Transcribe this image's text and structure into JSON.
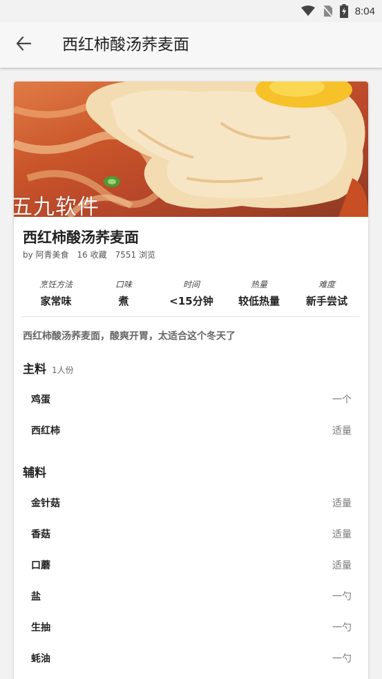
{
  "status_bar": {
    "time": "8:04",
    "icons": [
      "wifi-icon",
      "no-sim-icon",
      "battery-charging-icon"
    ]
  },
  "app_bar": {
    "back_icon": "arrow-left-icon",
    "title": "西红柿酸汤荞麦面"
  },
  "hero": {
    "watermark": "五九软件"
  },
  "recipe": {
    "title": "西红柿酸汤荞麦面",
    "author": "by 阿青美食",
    "favorites": "16 收藏",
    "views": "7551 浏览",
    "attributes": [
      {
        "label": "烹饪方法",
        "value": "家常味"
      },
      {
        "label": "口味",
        "value": "煮"
      },
      {
        "label": "时间",
        "value": "<15分钟"
      },
      {
        "label": "热量",
        "value": "较低热量"
      },
      {
        "label": "难度",
        "value": "新手尝试"
      }
    ],
    "description": "西红柿酸汤荞麦面，酸爽开胃，太适合这个冬天了"
  },
  "main_ingredients": {
    "title": "主料",
    "servings": "1人份",
    "items": [
      {
        "name": "鸡蛋",
        "qty": "一个"
      },
      {
        "name": "西红柿",
        "qty": "适量"
      }
    ]
  },
  "auxiliary_ingredients": {
    "title": "辅料",
    "items": [
      {
        "name": "金针菇",
        "qty": "适量"
      },
      {
        "name": "香菇",
        "qty": "适量"
      },
      {
        "name": "口蘑",
        "qty": "适量"
      },
      {
        "name": "盐",
        "qty": "一勺"
      },
      {
        "name": "生抽",
        "qty": "一勺"
      },
      {
        "name": "蚝油",
        "qty": "一勺"
      }
    ]
  },
  "colors": {
    "background": "#f2f2f2",
    "card": "#ffffff",
    "text_primary": "#222222",
    "text_secondary": "#777777"
  }
}
